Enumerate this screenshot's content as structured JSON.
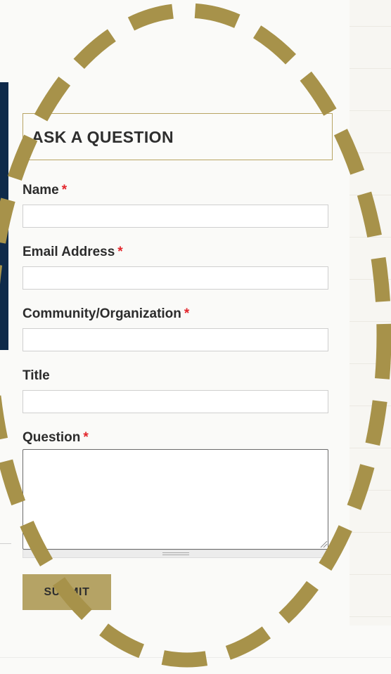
{
  "form": {
    "title": "ASK A QUESTION",
    "required_marker": "*",
    "fields": {
      "name": {
        "label": "Name",
        "value": "",
        "placeholder": ""
      },
      "email": {
        "label": "Email Address",
        "value": "",
        "placeholder": ""
      },
      "community": {
        "label": "Community/Organization",
        "value": "",
        "placeholder": ""
      },
      "title": {
        "label": "Title",
        "value": "",
        "placeholder": ""
      },
      "question": {
        "label": "Question",
        "value": "",
        "placeholder": ""
      }
    },
    "submit_label": "SUBMIT"
  },
  "colors": {
    "accent_gold": "#b5a365",
    "ellipse_gold": "#a7924a",
    "navy": "#0f2a4a",
    "required_red": "#e3262c",
    "title_border": "#b8a463"
  },
  "icons": {
    "resize_grip": "resize-grip-icon",
    "drag_handle": "drag-handle-icon"
  }
}
